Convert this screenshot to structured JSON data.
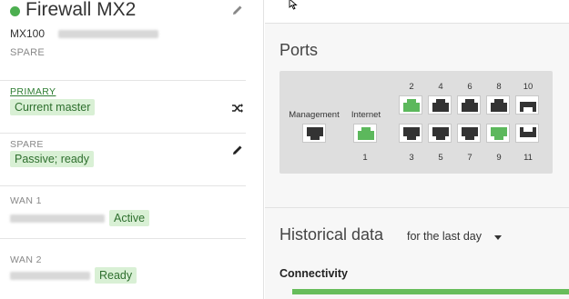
{
  "device": {
    "name": "Firewall MX2",
    "model": "MX100",
    "role": "SPARE",
    "status_color": "#4caf50"
  },
  "primary": {
    "label": "PRIMARY",
    "badge": "Current master"
  },
  "spare": {
    "label": "SPARE",
    "badge": "Passive; ready"
  },
  "wan1": {
    "label": "WAN 1",
    "badge": "Active"
  },
  "wan2": {
    "label": "WAN 2",
    "badge": "Ready"
  },
  "ports": {
    "title": "Ports",
    "management_label": "Management",
    "internet_label": "Internet",
    "internet_number": "1",
    "top_numbers": [
      "2",
      "4",
      "6",
      "8",
      "10"
    ],
    "bottom_numbers": [
      "3",
      "5",
      "7",
      "9",
      "11"
    ],
    "active_color": "#5cb85c",
    "idle_color": "#333333"
  },
  "historical": {
    "title": "Historical data",
    "range": "for the last day",
    "connectivity_label": "Connectivity",
    "connectivity_color": "#67bd5b"
  },
  "icons": {
    "edit": "pencil-icon",
    "swap": "shuffle-icon",
    "cursor": "mouse-pointer-icon"
  }
}
